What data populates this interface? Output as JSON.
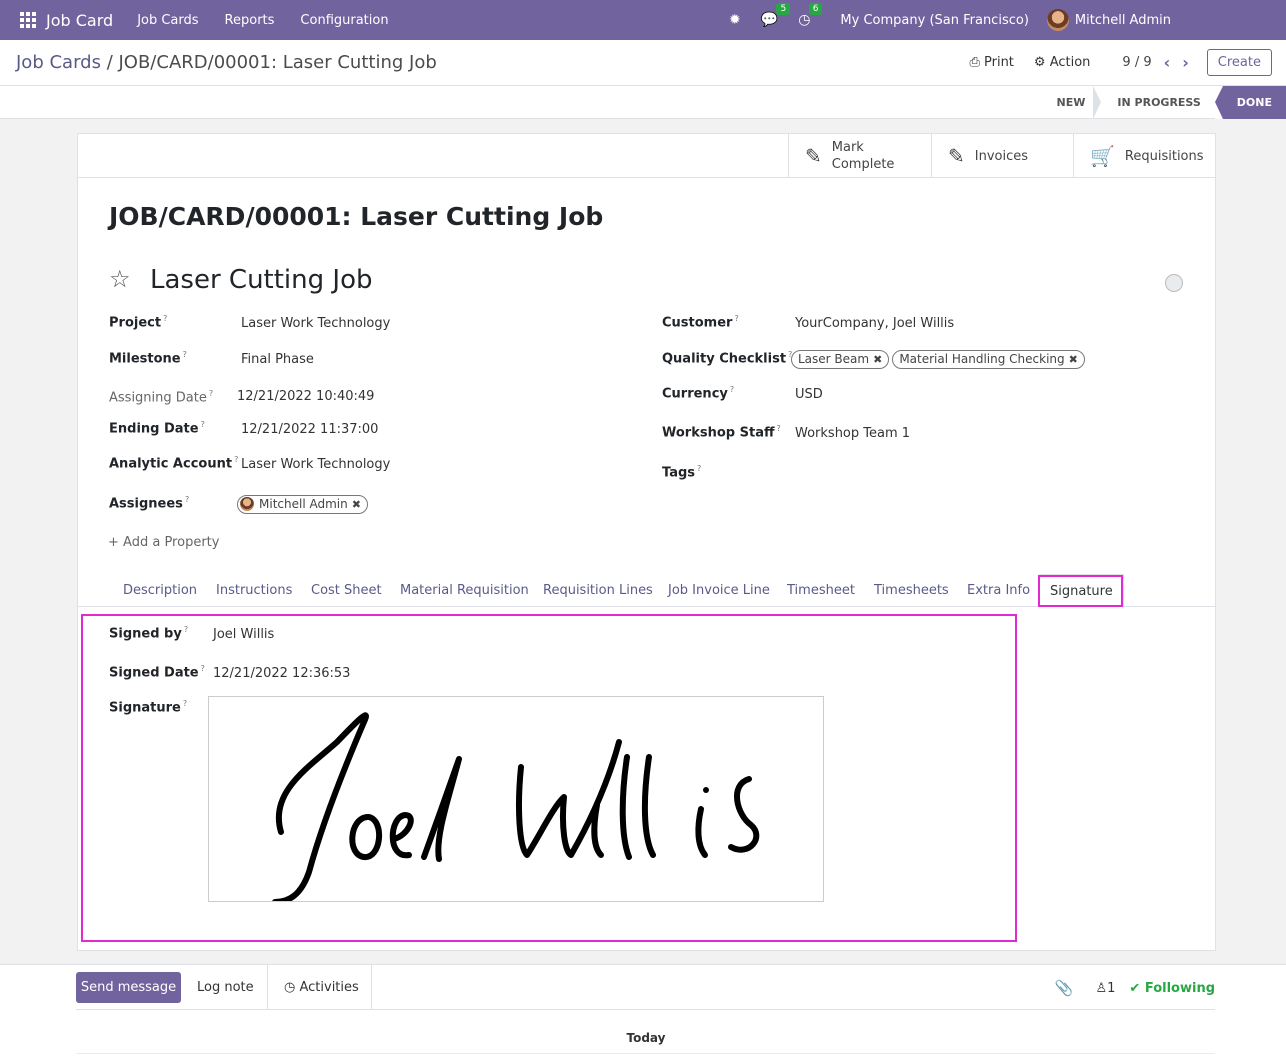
{
  "topbar": {
    "brand": "Job Card",
    "menu": [
      "Job Cards",
      "Reports",
      "Configuration"
    ],
    "messages_badge": "5",
    "activities_badge": "6",
    "company": "My Company (San Francisco)",
    "user": "Mitchell Admin"
  },
  "control": {
    "breadcrumb_parent": "Job Cards",
    "breadcrumb_sep": " / ",
    "breadcrumb_current": "JOB/CARD/00001: Laser Cutting Job",
    "print_label": "Print",
    "action_label": "Action",
    "pager": "9 / 9",
    "create_label": "Create"
  },
  "statusbar": {
    "stages": [
      "NEW",
      "IN PROGRESS",
      "DONE"
    ],
    "active": "DONE"
  },
  "buttonbox": {
    "mark_complete": "Mark Complete",
    "mark_line1": "Mark",
    "mark_line2": "Complete",
    "invoices": "Invoices",
    "requisitions": "Requisitions"
  },
  "form": {
    "reference": "JOB/CARD/00001: Laser Cutting Job",
    "name": "Laser Cutting Job",
    "fields_left": {
      "project_label": "Project",
      "project": "Laser Work Technology",
      "milestone_label": "Milestone",
      "milestone": "Final Phase",
      "assigning_date_label": "Assigning Date",
      "assigning_date": "12/21/2022 10:40:49",
      "ending_date_label": "Ending Date",
      "ending_date": "12/21/2022 11:37:00",
      "analytic_account_label": "Analytic Account",
      "analytic_account": "Laser Work Technology",
      "assignees_label": "Assignees",
      "assignees": [
        "Mitchell Admin"
      ]
    },
    "fields_right": {
      "customer_label": "Customer",
      "customer": "YourCompany, Joel Willis",
      "quality_checklist_label": "Quality Checklist",
      "quality_checklist": [
        "Laser Beam",
        "Material Handling Checking"
      ],
      "currency_label": "Currency",
      "currency": "USD",
      "workshop_staff_label": "Workshop Staff",
      "workshop_staff": "Workshop Team 1",
      "tags_label": "Tags"
    },
    "add_property": "Add a Property",
    "help_mark": "?"
  },
  "tabs": [
    "Description",
    "Instructions",
    "Cost Sheet",
    "Material Requisition",
    "Requisition Lines",
    "Job Invoice Line",
    "Timesheet",
    "Timesheets",
    "Extra Info",
    "Signature"
  ],
  "active_tab": "Signature",
  "signature_tab": {
    "signed_by_label": "Signed by",
    "signed_by": "Joel Willis",
    "signed_date_label": "Signed Date",
    "signed_date": "12/21/2022 12:36:53",
    "signature_label": "Signature",
    "signature_text": "Joel Willis"
  },
  "chatter": {
    "send_message": "Send message",
    "log_note": "Log note",
    "activities": "Activities",
    "followers_count": "1",
    "following": "Following",
    "today": "Today"
  },
  "colors": {
    "brand": "#71639e",
    "highlight": "#e22ad2",
    "following": "#28a745"
  }
}
